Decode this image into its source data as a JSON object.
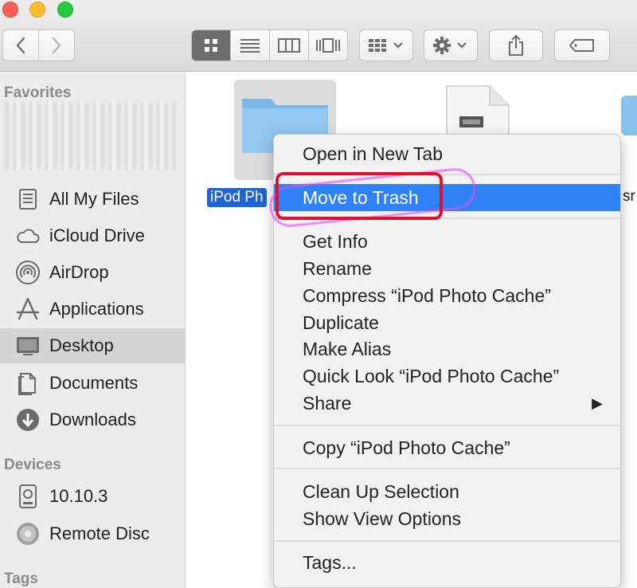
{
  "toolbar": {
    "back_icon": "chevron-left-icon",
    "forward_icon": "chevron-right-icon",
    "views": [
      "icon-view-icon",
      "list-view-icon",
      "column-view-icon",
      "coverflow-view-icon"
    ],
    "active_view": 0,
    "buttons": [
      "arrange-icon",
      "gear-icon",
      "share-icon",
      "tag-icon"
    ]
  },
  "sidebar": {
    "favorites_title": "Favorites",
    "favorites": [
      {
        "label": "All My Files",
        "icon": "all-files-icon"
      },
      {
        "label": "iCloud Drive",
        "icon": "cloud-icon"
      },
      {
        "label": "AirDrop",
        "icon": "airdrop-icon"
      },
      {
        "label": "Applications",
        "icon": "applications-icon"
      },
      {
        "label": "Desktop",
        "icon": "desktop-icon",
        "selected": true
      },
      {
        "label": "Documents",
        "icon": "documents-icon"
      },
      {
        "label": "Downloads",
        "icon": "downloads-icon"
      }
    ],
    "devices_title": "Devices",
    "devices": [
      {
        "label": "10.10.3",
        "icon": "hard-drive-icon"
      },
      {
        "label": "Remote Disc",
        "icon": "disc-icon"
      }
    ],
    "tags_title": "Tags"
  },
  "files": {
    "selected_label": "iPod Ph",
    "right_label": "sr"
  },
  "context_menu": {
    "items": [
      {
        "label": "Open in New Tab"
      },
      {
        "label": "Move to Trash",
        "highlighted": true
      },
      {
        "label": "Get Info"
      },
      {
        "label": "Rename"
      },
      {
        "label": "Compress “iPod Photo Cache”"
      },
      {
        "label": "Duplicate"
      },
      {
        "label": "Make Alias"
      },
      {
        "label": "Quick Look “iPod Photo Cache”"
      },
      {
        "label": "Share",
        "submenu": true
      },
      {
        "label": "Copy “iPod Photo Cache”"
      },
      {
        "label": "Clean Up Selection"
      },
      {
        "label": "Show View Options"
      },
      {
        "label": "Tags..."
      }
    ],
    "submenu_arrow": "▶"
  },
  "colors": {
    "selection_blue": "#1f63d8",
    "menu_highlight": "#2f82f6",
    "annotation_red": "#e0102f",
    "annotation_pink": "#e050e8",
    "folder_blue": "#8ac0ec"
  }
}
